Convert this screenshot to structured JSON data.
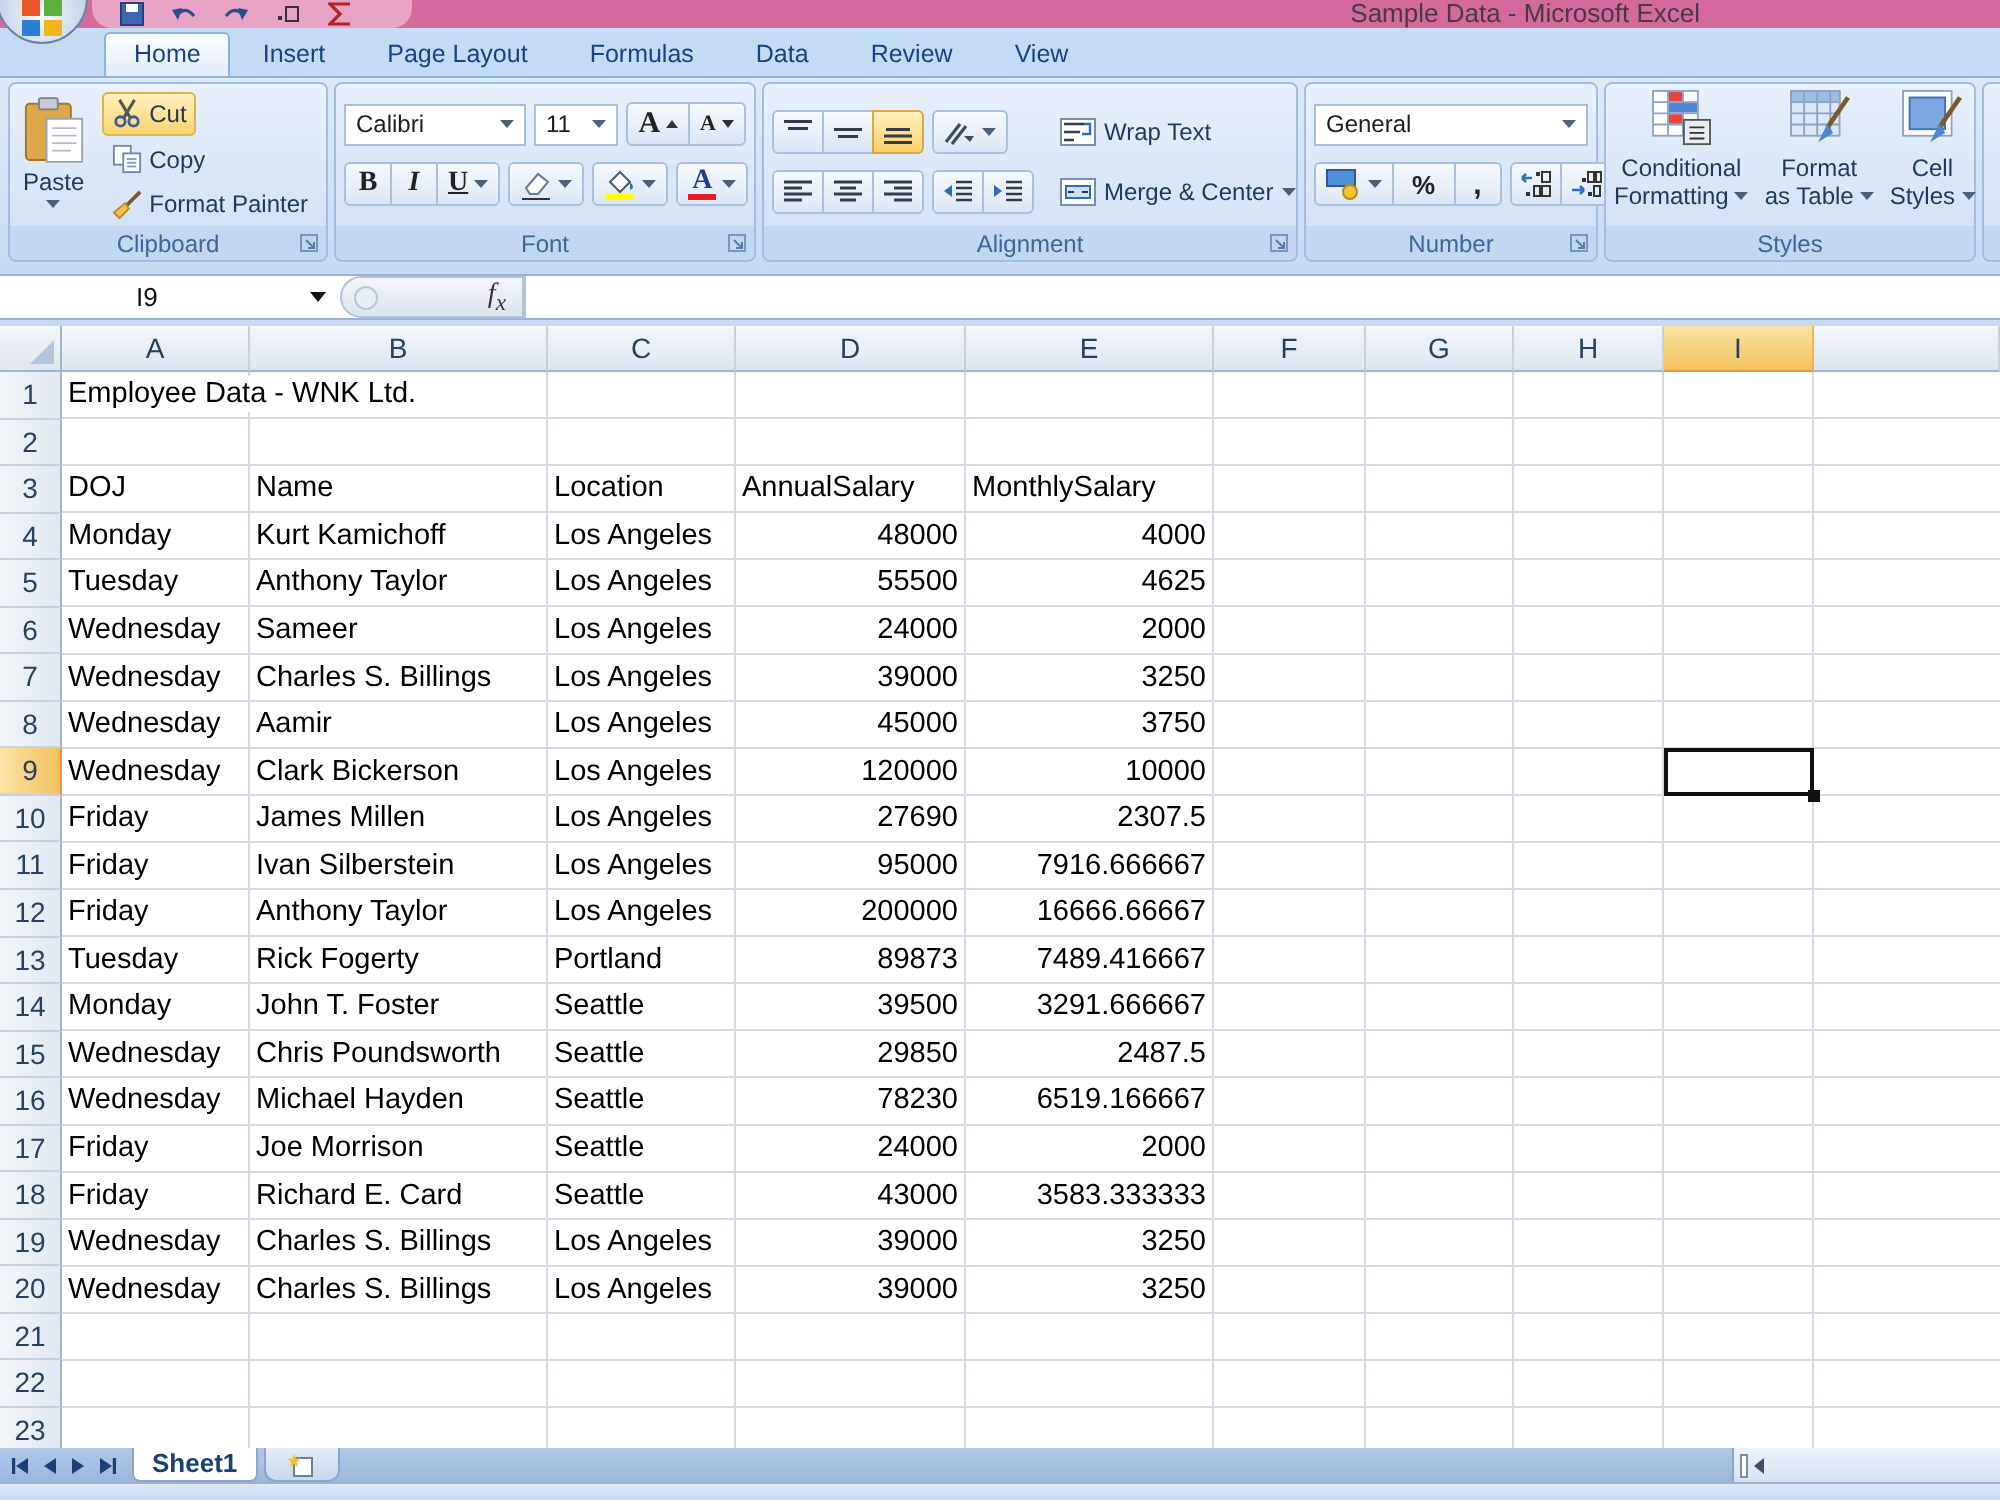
{
  "window": {
    "title": "Sample Data - Microsoft Excel"
  },
  "ribbon_tabs": [
    {
      "label": "Home",
      "selected": true
    },
    {
      "label": "Insert",
      "selected": false
    },
    {
      "label": "Page Layout",
      "selected": false
    },
    {
      "label": "Formulas",
      "selected": false
    },
    {
      "label": "Data",
      "selected": false
    },
    {
      "label": "Review",
      "selected": false
    },
    {
      "label": "View",
      "selected": false
    }
  ],
  "clipboard": {
    "label": "Clipboard",
    "paste": "Paste",
    "commands": [
      {
        "label": "Cut",
        "kind": "cut",
        "highlighted": true
      },
      {
        "label": "Copy",
        "kind": "copy",
        "highlighted": false
      },
      {
        "label": "Format Painter",
        "kind": "painter",
        "highlighted": false
      }
    ]
  },
  "font": {
    "label": "Font",
    "font_name": "Calibri",
    "font_size": "11",
    "grow": "A",
    "shrink": "A",
    "styles": [
      "B",
      "I",
      "U"
    ],
    "color_letter": "A"
  },
  "alignment": {
    "label": "Alignment",
    "vertical": [
      {
        "kind": "top",
        "selected": false
      },
      {
        "kind": "middle",
        "selected": false
      },
      {
        "kind": "bottom",
        "selected": true
      }
    ],
    "horizontal": [
      {
        "kind": "left",
        "selected": false
      },
      {
        "kind": "center",
        "selected": false
      },
      {
        "kind": "right",
        "selected": false
      }
    ],
    "wrap_text": "Wrap Text",
    "merge_center": "Merge & Center"
  },
  "number": {
    "label": "Number",
    "format": "General",
    "percent": "%",
    "comma": ","
  },
  "styles": {
    "label": "Styles",
    "buttons": [
      {
        "kind": "conditional",
        "lines": [
          "Conditional",
          "Formatting"
        ]
      },
      {
        "kind": "table",
        "lines": [
          "Format",
          "as Table"
        ]
      },
      {
        "kind": "cell",
        "lines": [
          "Cell",
          "Styles"
        ]
      }
    ]
  },
  "formula_bar": {
    "name_box": "I9",
    "function_symbol": "f$_{x}$"
  },
  "columns": [
    {
      "label": "A",
      "selected": false
    },
    {
      "label": "B",
      "selected": false
    },
    {
      "label": "C",
      "selected": false
    },
    {
      "label": "D",
      "selected": false
    },
    {
      "label": "E",
      "selected": false
    },
    {
      "label": "F",
      "selected": false
    },
    {
      "label": "G",
      "selected": false
    },
    {
      "label": "H",
      "selected": false
    },
    {
      "label": "I",
      "selected": true
    }
  ],
  "rows": [
    {
      "label": "1",
      "selected": false,
      "cells": [
        {
          "text": "Employee Data - WNK Ltd.",
          "kind": "text"
        }
      ]
    },
    {
      "label": "2",
      "selected": false
    },
    {
      "label": "3",
      "selected": false,
      "cells": [
        {
          "text": "DOJ",
          "kind": "text"
        },
        {
          "text": "Name",
          "kind": "text"
        },
        {
          "text": "Location",
          "kind": "text"
        },
        {
          "text": "AnnualSalary",
          "kind": "text"
        },
        {
          "text": "MonthlySalary",
          "kind": "text"
        }
      ]
    },
    {
      "label": "4",
      "selected": false,
      "cells": [
        {
          "text": "Monday",
          "kind": "text"
        },
        {
          "text": "Kurt Kamichoff",
          "kind": "text"
        },
        {
          "text": "Los Angeles",
          "kind": "text"
        },
        {
          "text": "48000",
          "kind": "number"
        },
        {
          "text": "4000",
          "kind": "number"
        }
      ]
    },
    {
      "label": "5",
      "selected": false,
      "cells": [
        {
          "text": "Tuesday",
          "kind": "text"
        },
        {
          "text": "Anthony Taylor",
          "kind": "text"
        },
        {
          "text": "Los Angeles",
          "kind": "text"
        },
        {
          "text": "55500",
          "kind": "number"
        },
        {
          "text": "4625",
          "kind": "number"
        }
      ]
    },
    {
      "label": "6",
      "selected": false,
      "cells": [
        {
          "text": "Wednesday",
          "kind": "text"
        },
        {
          "text": "Sameer",
          "kind": "text"
        },
        {
          "text": "Los Angeles",
          "kind": "text"
        },
        {
          "text": "24000",
          "kind": "number"
        },
        {
          "text": "2000",
          "kind": "number"
        }
      ]
    },
    {
      "label": "7",
      "selected": false,
      "cells": [
        {
          "text": "Wednesday",
          "kind": "text"
        },
        {
          "text": "Charles S. Billings",
          "kind": "text"
        },
        {
          "text": "Los Angeles",
          "kind": "text"
        },
        {
          "text": "39000",
          "kind": "number"
        },
        {
          "text": "3250",
          "kind": "number"
        }
      ]
    },
    {
      "label": "8",
      "selected": false,
      "cells": [
        {
          "text": "Wednesday",
          "kind": "text"
        },
        {
          "text": "Aamir",
          "kind": "text"
        },
        {
          "text": "Los Angeles",
          "kind": "text"
        },
        {
          "text": "45000",
          "kind": "number"
        },
        {
          "text": "3750",
          "kind": "number"
        }
      ]
    },
    {
      "label": "9",
      "selected": true,
      "cells": [
        {
          "text": "Wednesday",
          "kind": "text"
        },
        {
          "text": "Clark Bickerson",
          "kind": "text"
        },
        {
          "text": "Los Angeles",
          "kind": "text"
        },
        {
          "text": "120000",
          "kind": "number"
        },
        {
          "text": "10000",
          "kind": "number"
        }
      ]
    },
    {
      "label": "10",
      "selected": false,
      "cells": [
        {
          "text": "Friday",
          "kind": "text"
        },
        {
          "text": "James Millen",
          "kind": "text"
        },
        {
          "text": "Los Angeles",
          "kind": "text"
        },
        {
          "text": "27690",
          "kind": "number"
        },
        {
          "text": "2307.5",
          "kind": "number"
        }
      ]
    },
    {
      "label": "11",
      "selected": false,
      "cells": [
        {
          "text": "Friday",
          "kind": "text"
        },
        {
          "text": "Ivan Silberstein",
          "kind": "text"
        },
        {
          "text": "Los Angeles",
          "kind": "text"
        },
        {
          "text": "95000",
          "kind": "number"
        },
        {
          "text": "7916.666667",
          "kind": "number"
        }
      ]
    },
    {
      "label": "12",
      "selected": false,
      "cells": [
        {
          "text": "Friday",
          "kind": "text"
        },
        {
          "text": "Anthony Taylor",
          "kind": "text"
        },
        {
          "text": "Los Angeles",
          "kind": "text"
        },
        {
          "text": "200000",
          "kind": "number"
        },
        {
          "text": "16666.66667",
          "kind": "number"
        }
      ]
    },
    {
      "label": "13",
      "selected": false,
      "cells": [
        {
          "text": "Tuesday",
          "kind": "text"
        },
        {
          "text": "Rick Fogerty",
          "kind": "text"
        },
        {
          "text": "Portland",
          "kind": "text"
        },
        {
          "text": "89873",
          "kind": "number"
        },
        {
          "text": "7489.416667",
          "kind": "number"
        }
      ]
    },
    {
      "label": "14",
      "selected": false,
      "cells": [
        {
          "text": "Monday",
          "kind": "text"
        },
        {
          "text": "John T. Foster",
          "kind": "text"
        },
        {
          "text": "Seattle",
          "kind": "text"
        },
        {
          "text": "39500",
          "kind": "number"
        },
        {
          "text": "3291.666667",
          "kind": "number"
        }
      ]
    },
    {
      "label": "15",
      "selected": false,
      "cells": [
        {
          "text": "Wednesday",
          "kind": "text"
        },
        {
          "text": "Chris Poundsworth",
          "kind": "text"
        },
        {
          "text": "Seattle",
          "kind": "text"
        },
        {
          "text": "29850",
          "kind": "number"
        },
        {
          "text": "2487.5",
          "kind": "number"
        }
      ]
    },
    {
      "label": "16",
      "selected": false,
      "cells": [
        {
          "text": "Wednesday",
          "kind": "text"
        },
        {
          "text": "Michael Hayden",
          "kind": "text"
        },
        {
          "text": "Seattle",
          "kind": "text"
        },
        {
          "text": "78230",
          "kind": "number"
        },
        {
          "text": "6519.166667",
          "kind": "number"
        }
      ]
    },
    {
      "label": "17",
      "selected": false,
      "cells": [
        {
          "text": "Friday",
          "kind": "text"
        },
        {
          "text": "Joe Morrison",
          "kind": "text"
        },
        {
          "text": "Seattle",
          "kind": "text"
        },
        {
          "text": "24000",
          "kind": "number"
        },
        {
          "text": "2000",
          "kind": "number"
        }
      ]
    },
    {
      "label": "18",
      "selected": false,
      "cells": [
        {
          "text": "Friday",
          "kind": "text"
        },
        {
          "text": "Richard E. Card",
          "kind": "text"
        },
        {
          "text": "Seattle",
          "kind": "text"
        },
        {
          "text": "43000",
          "kind": "number"
        },
        {
          "text": "3583.333333",
          "kind": "number"
        }
      ]
    },
    {
      "label": "19",
      "selected": false,
      "cells": [
        {
          "text": "Wednesday",
          "kind": "text"
        },
        {
          "text": "Charles S. Billings",
          "kind": "text"
        },
        {
          "text": "Los Angeles",
          "kind": "text"
        },
        {
          "text": "39000",
          "kind": "number"
        },
        {
          "text": "3250",
          "kind": "number"
        }
      ]
    },
    {
      "label": "20",
      "selected": false,
      "cells": [
        {
          "text": "Wednesday",
          "kind": "text"
        },
        {
          "text": "Charles S. Billings",
          "kind": "text"
        },
        {
          "text": "Los Angeles",
          "kind": "text"
        },
        {
          "text": "39000",
          "kind": "number"
        },
        {
          "text": "3250",
          "kind": "number"
        }
      ]
    },
    {
      "label": "21",
      "selected": false
    },
    {
      "label": "22",
      "selected": false
    },
    {
      "label": "23",
      "selected": false
    }
  ],
  "sheet_tabs": [
    {
      "label": "Sheet1",
      "selected": true
    }
  ]
}
